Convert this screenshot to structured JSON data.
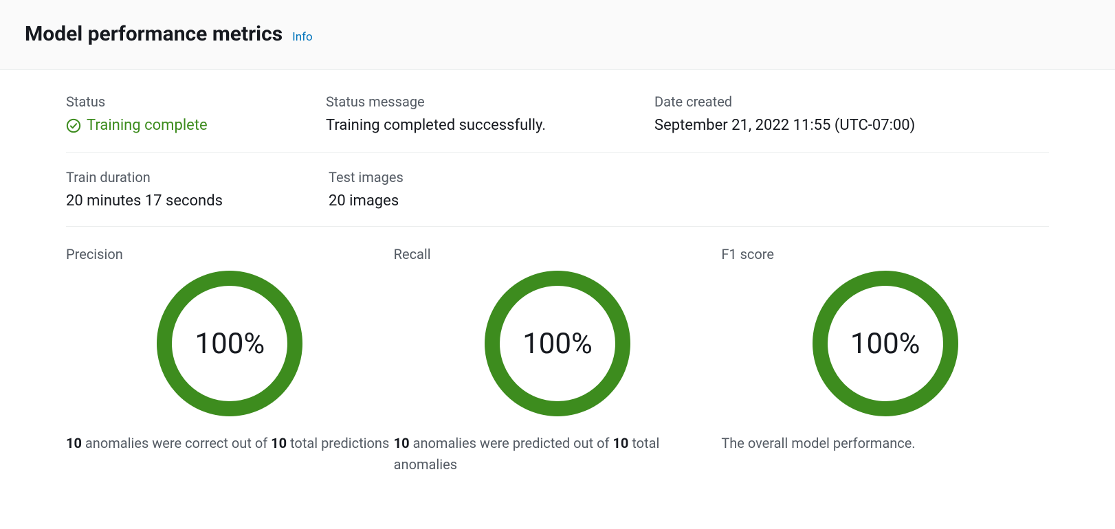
{
  "header": {
    "title": "Model performance metrics",
    "info_label": "Info"
  },
  "row1": {
    "status_label": "Status",
    "status_value": "Training complete",
    "status_message_label": "Status message",
    "status_message_value": "Training completed successfully.",
    "date_created_label": "Date created",
    "date_created_value": "September 21, 2022 11:55 (UTC-07:00)"
  },
  "row2": {
    "train_duration_label": "Train duration",
    "train_duration_value": "20 minutes 17 seconds",
    "test_images_label": "Test images",
    "test_images_value": "20 images"
  },
  "metrics": {
    "precision": {
      "label": "Precision",
      "pct": "100%",
      "desc_strong1": "10",
      "desc_text1": " anomalies were correct out of ",
      "desc_strong2": "10",
      "desc_text2": " total predictions"
    },
    "recall": {
      "label": "Recall",
      "pct": "100%",
      "desc_strong1": "10",
      "desc_text1": " anomalies were predicted out of ",
      "desc_strong2": "10",
      "desc_text2": " total anomalies"
    },
    "f1": {
      "label": "F1 score",
      "pct": "100%",
      "desc_text": "The overall model performance."
    }
  },
  "chart_data": [
    {
      "type": "pie",
      "title": "Precision",
      "values": [
        100
      ],
      "label": "100%"
    },
    {
      "type": "pie",
      "title": "Recall",
      "values": [
        100
      ],
      "label": "100%"
    },
    {
      "type": "pie",
      "title": "F1 score",
      "values": [
        100
      ],
      "label": "100%"
    }
  ],
  "colors": {
    "accent_green": "#3d8c1e",
    "link_blue": "#0073bb",
    "label_gray": "#545b64"
  }
}
